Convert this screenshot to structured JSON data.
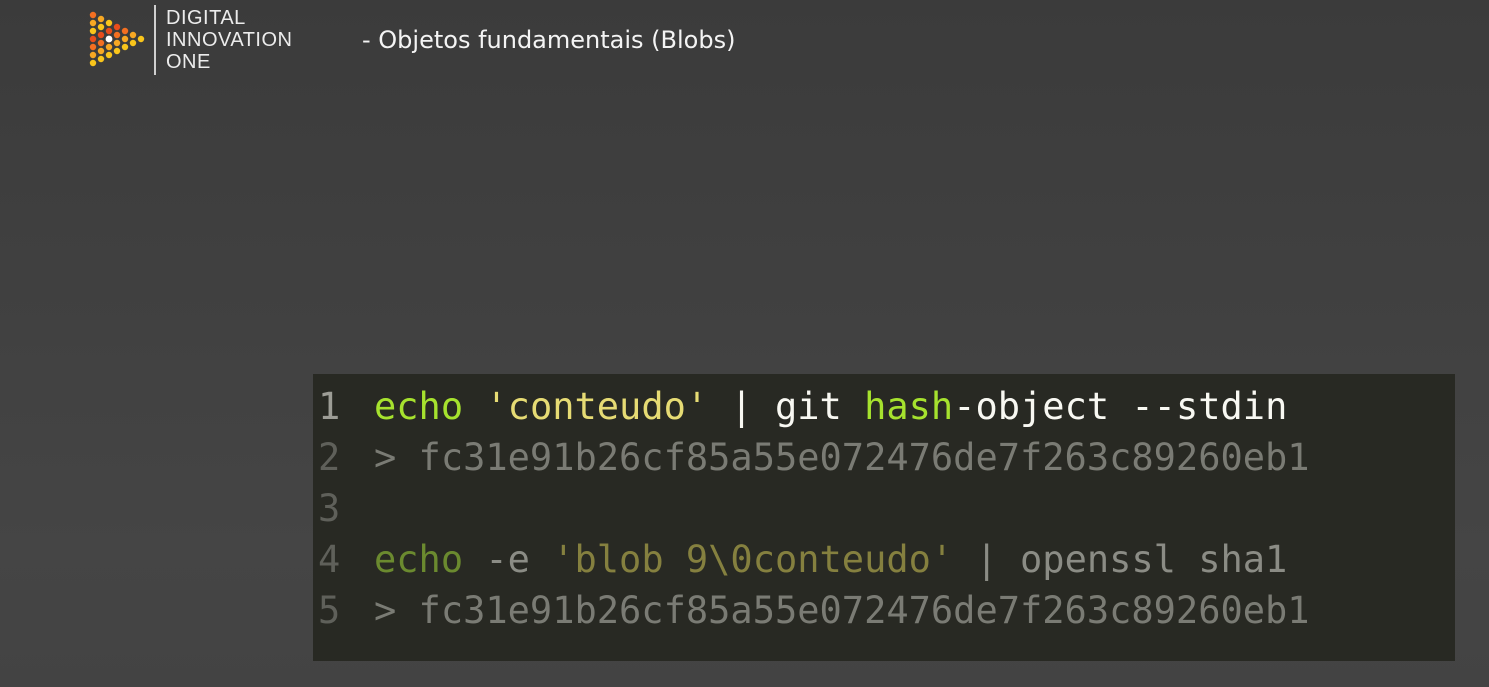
{
  "brand": {
    "line1": "DIGITAL",
    "line2": "INNOVATION",
    "line3": "ONE",
    "colors": [
      "#f36f21",
      "#f7a823",
      "#f9c51b",
      "#e84d1c"
    ]
  },
  "slide": {
    "title": "- Objetos fundamentais (Blobs)"
  },
  "code": {
    "lines": [
      {
        "number": "1",
        "tokens": [
          {
            "text": "echo",
            "role": "keyword"
          },
          {
            "text": " ",
            "role": "plain"
          },
          {
            "text": "'conteudo'",
            "role": "string"
          },
          {
            "text": " | git ",
            "role": "plain"
          },
          {
            "text": "hash",
            "role": "keyword"
          },
          {
            "text": "-object --stdin",
            "role": "plain"
          }
        ]
      },
      {
        "number": "2",
        "tokens": [
          {
            "text": "> fc31e91b26cf85a55e072476de7f263c89260eb1",
            "role": "output"
          }
        ]
      },
      {
        "number": "3",
        "tokens": []
      },
      {
        "number": "4",
        "tokens": [
          {
            "text": "echo",
            "role": "keyword"
          },
          {
            "text": " -e ",
            "role": "plain"
          },
          {
            "text": "'blob 9\\0conteudo'",
            "role": "string"
          },
          {
            "text": " | openssl sha1",
            "role": "plain"
          }
        ]
      },
      {
        "number": "5",
        "tokens": [
          {
            "text": "> fc31e91b26cf85a55e072476de7f263c89260eb1",
            "role": "output"
          }
        ]
      }
    ]
  }
}
